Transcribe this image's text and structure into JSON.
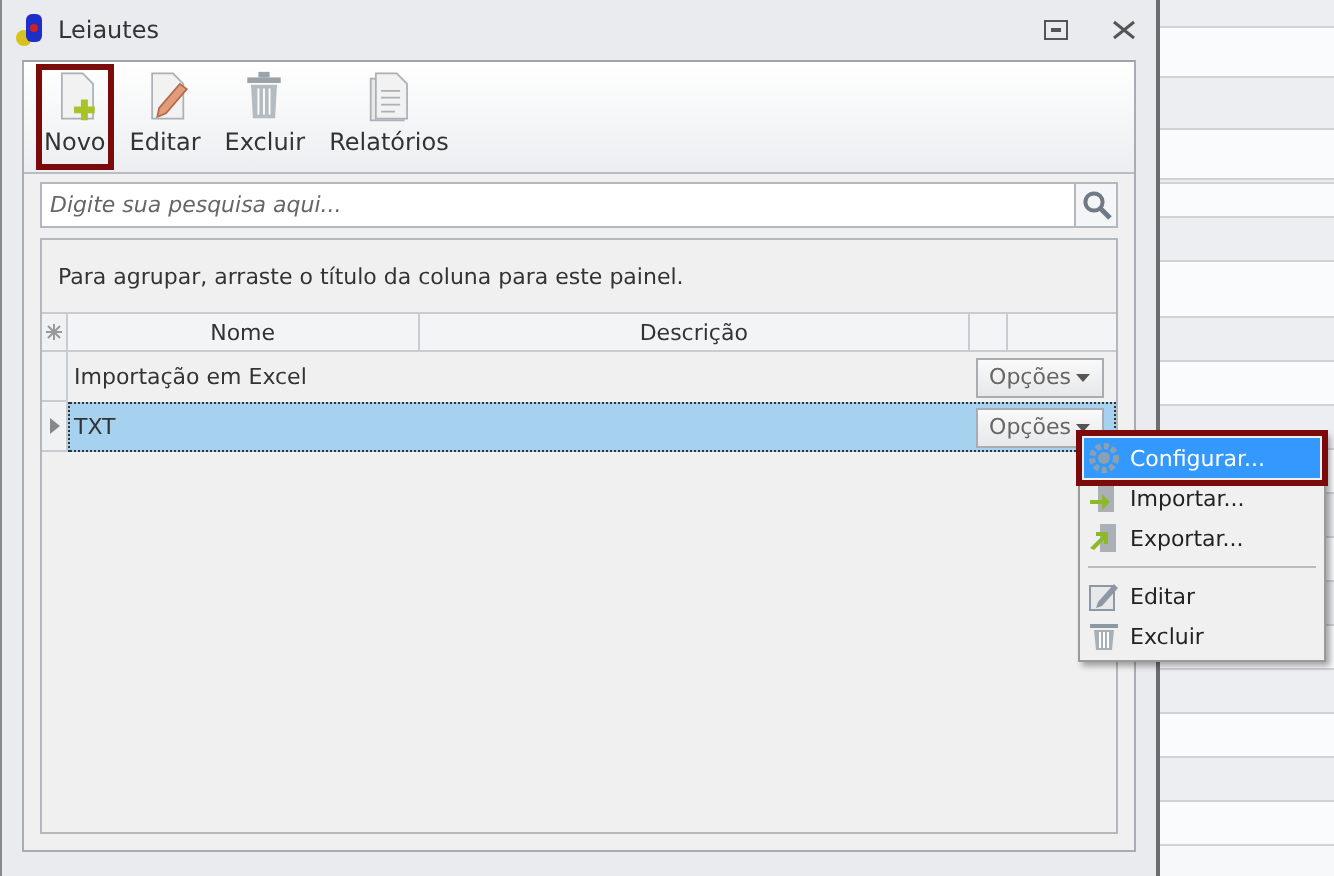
{
  "window": {
    "title": "Leiautes"
  },
  "toolbar": [
    {
      "label": "Novo",
      "highlighted": true
    },
    {
      "label": "Editar",
      "highlighted": false
    },
    {
      "label": "Excluir",
      "highlighted": false
    },
    {
      "label": "Relatórios",
      "highlighted": false
    }
  ],
  "search": {
    "placeholder": "Digite sua pesquisa aqui..."
  },
  "group_panel": {
    "hint": "Para agrupar, arraste o título da coluna para este painel."
  },
  "table": {
    "columns": [
      "Nome",
      "Descrição"
    ],
    "rows": [
      {
        "name": "Importação em Excel",
        "options": "Opções",
        "selected": false
      },
      {
        "name": "TXT",
        "options": "Opções",
        "selected": true
      }
    ]
  },
  "context_menu": {
    "groups": [
      [
        {
          "label": "Configurar...",
          "selected": true,
          "highlighted": true
        },
        {
          "label": "Importar...",
          "selected": false,
          "highlighted": false
        },
        {
          "label": "Exportar...",
          "selected": false,
          "highlighted": false
        }
      ],
      [
        {
          "label": "Editar",
          "selected": false,
          "highlighted": false
        },
        {
          "label": "Excluir",
          "selected": false,
          "highlighted": false
        }
      ]
    ]
  }
}
